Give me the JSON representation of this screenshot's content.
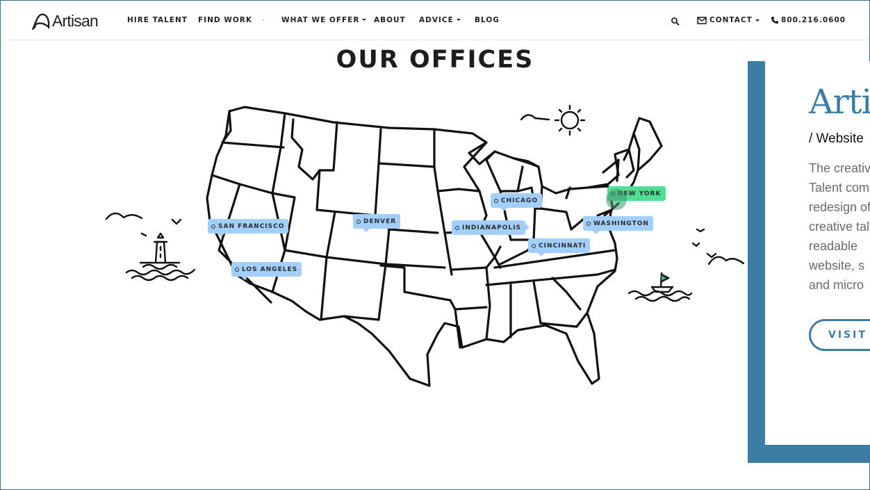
{
  "header": {
    "logo_text": "Artisan",
    "nav": [
      {
        "label": "HIRE TALENT"
      },
      {
        "label": "FIND WORK"
      },
      {
        "label": "WHAT WE OFFER"
      },
      {
        "label": "ABOUT"
      },
      {
        "label": "ADVICE"
      },
      {
        "label": "BLOG"
      }
    ],
    "contact_label": "CONTACT",
    "phone": "800.216.0600"
  },
  "offices": {
    "title": "OUR OFFICES",
    "locations": [
      {
        "name": "SAN FRANCISCO"
      },
      {
        "name": "LOS ANGELES"
      },
      {
        "name": "DENVER"
      },
      {
        "name": "CHICAGO"
      },
      {
        "name": "INDIANAPOLIS"
      },
      {
        "name": "CINCINNATI"
      },
      {
        "name": "NEW YORK",
        "active": true
      },
      {
        "name": "WASHINGTON"
      }
    ]
  },
  "project_panel": {
    "title": "Artisan",
    "subtitle": "/ Website",
    "description_lines": [
      "The creative",
      "Talent com",
      "redesign of",
      "creative tal",
      "readable",
      "website, s",
      "and micro"
    ],
    "visit_label": "VISIT"
  },
  "colors": {
    "accent_blue": "#3d7ca5",
    "pin_blue": "#a3cfff",
    "pin_active": "#4fdf94"
  }
}
